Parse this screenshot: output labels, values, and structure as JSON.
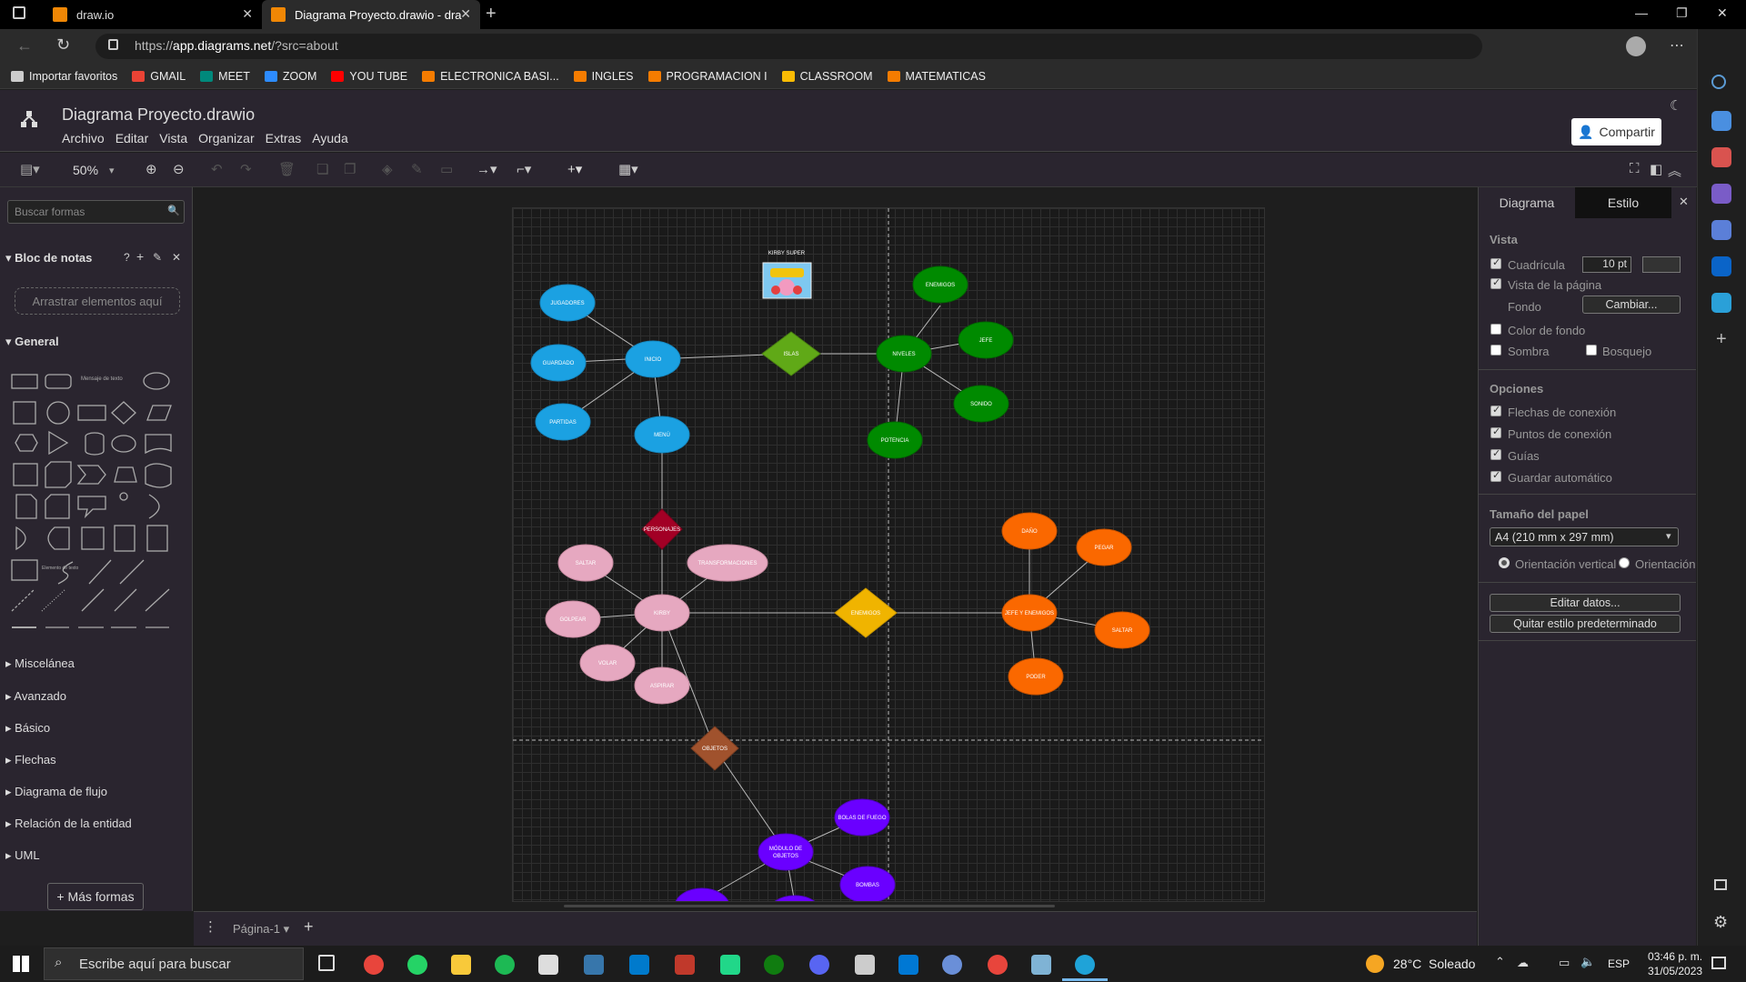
{
  "browser": {
    "tabs": [
      {
        "title": "draw.io"
      },
      {
        "title": "Diagrama Proyecto.drawio - dra"
      }
    ],
    "url_scheme": "https://",
    "url_host": "app.diagrams.net",
    "url_path": "/?src=about",
    "bookmarks": [
      "Importar favoritos",
      "GMAIL",
      "MEET",
      "ZOOM",
      "YOU TUBE",
      "ELECTRONICA BASI...",
      "INGLES",
      "PROGRAMACION I",
      "CLASSROOM",
      "MATEMATICAS"
    ]
  },
  "app": {
    "title": "Diagrama Proyecto.drawio",
    "menu": [
      "Archivo",
      "Editar",
      "Vista",
      "Organizar",
      "Extras",
      "Ayuda"
    ],
    "share_label": "Compartir",
    "zoom": "50%"
  },
  "left_panel": {
    "search_placeholder": "Buscar formas",
    "scratchpad": "Bloc de notas",
    "scratchpad_help": "?",
    "dropzone": "Arrastrar elementos aquí",
    "general": "General",
    "sections": [
      "Miscelánea",
      "Avanzado",
      "Básico",
      "Flechas",
      "Diagrama de flujo",
      "Relación de la entidad",
      "UML"
    ],
    "more_shapes": "+ Más formas",
    "shape_text_label": "Elemento de texto",
    "shape_text_label_short": "Mensaje de texto"
  },
  "page_tab": "Página-1",
  "right_panel": {
    "tabs": [
      "Diagrama",
      "Estilo"
    ],
    "vista": "Vista",
    "cuadricula": "Cuadrícula",
    "grid_size": "10 pt",
    "vista_pagina": "Vista de la página",
    "fondo": "Fondo",
    "cambiar": "Cambiar...",
    "color_fondo": "Color de fondo",
    "sombra": "Sombra",
    "bosquejo": "Bosquejo",
    "opciones": "Opciones",
    "flechas": "Flechas de conexión",
    "puntos": "Puntos de conexión",
    "guias": "Guías",
    "guardar": "Guardar automático",
    "tamano": "Tamaño del papel",
    "paper": "A4 (210 mm x 297 mm)",
    "vertical": "Orientación vertical",
    "horizontal": "Orientación",
    "editar": "Editar datos...",
    "quitar": "Quitar estilo predeterminado"
  },
  "diagram": {
    "title_label": "KIRBY SUPER",
    "nodes": {
      "jugadores": "JUGADORES",
      "guardado": "GUARDADO",
      "partidas": "PARTIDAS",
      "inicio": "INICIO",
      "menu": "MENÚ",
      "islas": "ISLAS",
      "niveles": "NIVELES",
      "enemigos_top": "ENEMIGOS",
      "jefe": "JEFE",
      "sonido": "SONIDO",
      "potencia": "POTENCIA",
      "personajes": "PERSONAJES",
      "saltar": "SALTAR",
      "transformaciones": "TRANSFORMACIONES",
      "golpear": "GOLPEAR",
      "kirby": "KIRBY",
      "volar": "VOLAR",
      "aspirar": "ASPIRAR",
      "enemigos_mid": "ENEMIGOS",
      "dano": "DAÑO",
      "pegar": "PEGAR",
      "jefe_enemigos": "JEFE Y ENEMIGOS",
      "saltar2": "SALTAR",
      "poder": "PODER",
      "objetos": "OBJETOS",
      "bolas": "BOLAS DE FUEGO",
      "modulo1": "MÓDULO DE",
      "modulo2": "OBJETOS",
      "bombas": "BOMBAS"
    },
    "colors": {
      "blue": "#1ba1e2",
      "green": "#008a00",
      "lightgreen": "#60a917",
      "crimson": "#a20025",
      "pink": "#e6a8c0",
      "yellow": "#f0b400",
      "orange": "#fa6800",
      "brown": "#a0522d",
      "purple": "#6a00ff"
    }
  },
  "taskbar": {
    "search": "Escribe aquí para buscar",
    "weather": "28°C  Soleado",
    "lang": "ESP",
    "time": "03:46 p. m.",
    "date": "31/05/2023"
  }
}
